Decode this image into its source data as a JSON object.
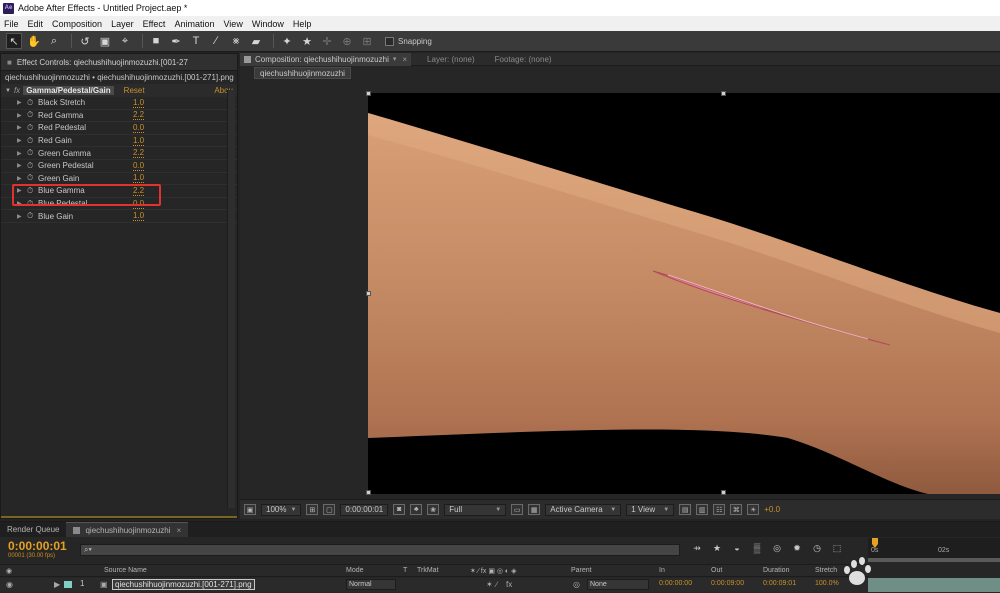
{
  "window": {
    "title": "Adobe After Effects - Untitled Project.aep *",
    "logo": "Ae"
  },
  "menu": [
    "File",
    "Edit",
    "Composition",
    "Layer",
    "Effect",
    "Animation",
    "View",
    "Window",
    "Help"
  ],
  "toolbar": {
    "tools": [
      "selection-tool",
      "hand-tool",
      "zoom-tool",
      "rotation-tool",
      "camera-orbit-tool",
      "pan-behind-tool",
      "rectangle-tool",
      "pen-tool",
      "text-tool",
      "brush-tool",
      "clone-stamp-tool",
      "eraser-tool",
      "roto-brush-tool",
      "puppet-pin-tool"
    ],
    "snapping_label": "Snapping",
    "snapping_checked": false
  },
  "effect_controls": {
    "tab_label": "Effect Controls: qiechushihuojinmozuzhi.[001-27",
    "source_line": "qiechushihuojinmozuzhi • qiechushihuojinmozuzhi.[001-271].png",
    "effect": {
      "badge": "fx",
      "name": "Gamma/Pedestal/Gain",
      "reset": "Reset",
      "about": "Abou"
    },
    "params": [
      {
        "name": "Black Stretch",
        "value": "1.0"
      },
      {
        "name": "Red Gamma",
        "value": "2.2"
      },
      {
        "name": "Red Pedestal",
        "value": "0.0"
      },
      {
        "name": "Red Gain",
        "value": "1.0"
      },
      {
        "name": "Green Gamma",
        "value": "2.2"
      },
      {
        "name": "Green Pedestal",
        "value": "0.0"
      },
      {
        "name": "Green Gain",
        "value": "1.0"
      },
      {
        "name": "Blue Gamma",
        "value": "2.2"
      },
      {
        "name": "Blue Pedestal",
        "value": "0.0"
      },
      {
        "name": "Blue Gain",
        "value": "1.0"
      }
    ],
    "highlighted_param": "Blue Gamma",
    "highlight_color": "#e0322f"
  },
  "composition": {
    "tab_label": "Composition: qiechushihuojinmozuzhi",
    "layer_tab": "Layer: (none)",
    "footage_tab": "Footage: (none)",
    "subtab": "qiechushihuojinmozuzhi",
    "footer": {
      "zoom": "100%",
      "timecode": "0:00:00:01",
      "resolution": "Full",
      "camera": "Active Camera",
      "views": "1 View",
      "exposure": "+0.0"
    }
  },
  "timeline": {
    "render_queue_tab": "Render Queue",
    "comp_tab": "qiechushihuojinmozuzhi",
    "timecode": "0:00:00:01",
    "frames_fps": "00001 (30.00 fps)",
    "search_placeholder": "⌕▾",
    "ruler": {
      "start": "0s",
      "mark": "02s"
    },
    "columns": {
      "source_name": "Source Name",
      "mode": "Mode",
      "t": "T",
      "trkmat": "TrkMat",
      "parent": "Parent",
      "in": "In",
      "out": "Out",
      "duration": "Duration",
      "stretch": "Stretch"
    },
    "layer": {
      "number": "1",
      "name": "qiechushihuojinmozuzhi.[001-271].png",
      "mode": "Normal",
      "parent": "None",
      "in": "0:00:00:00",
      "out": "0:00:09:00",
      "duration": "0:00:09:01",
      "stretch": "100.0%",
      "label_color": "#7fd0c2"
    }
  },
  "colors": {
    "accent_orange": "#e6a023",
    "value_orange": "#c8922c",
    "panel_bg": "#262626"
  }
}
